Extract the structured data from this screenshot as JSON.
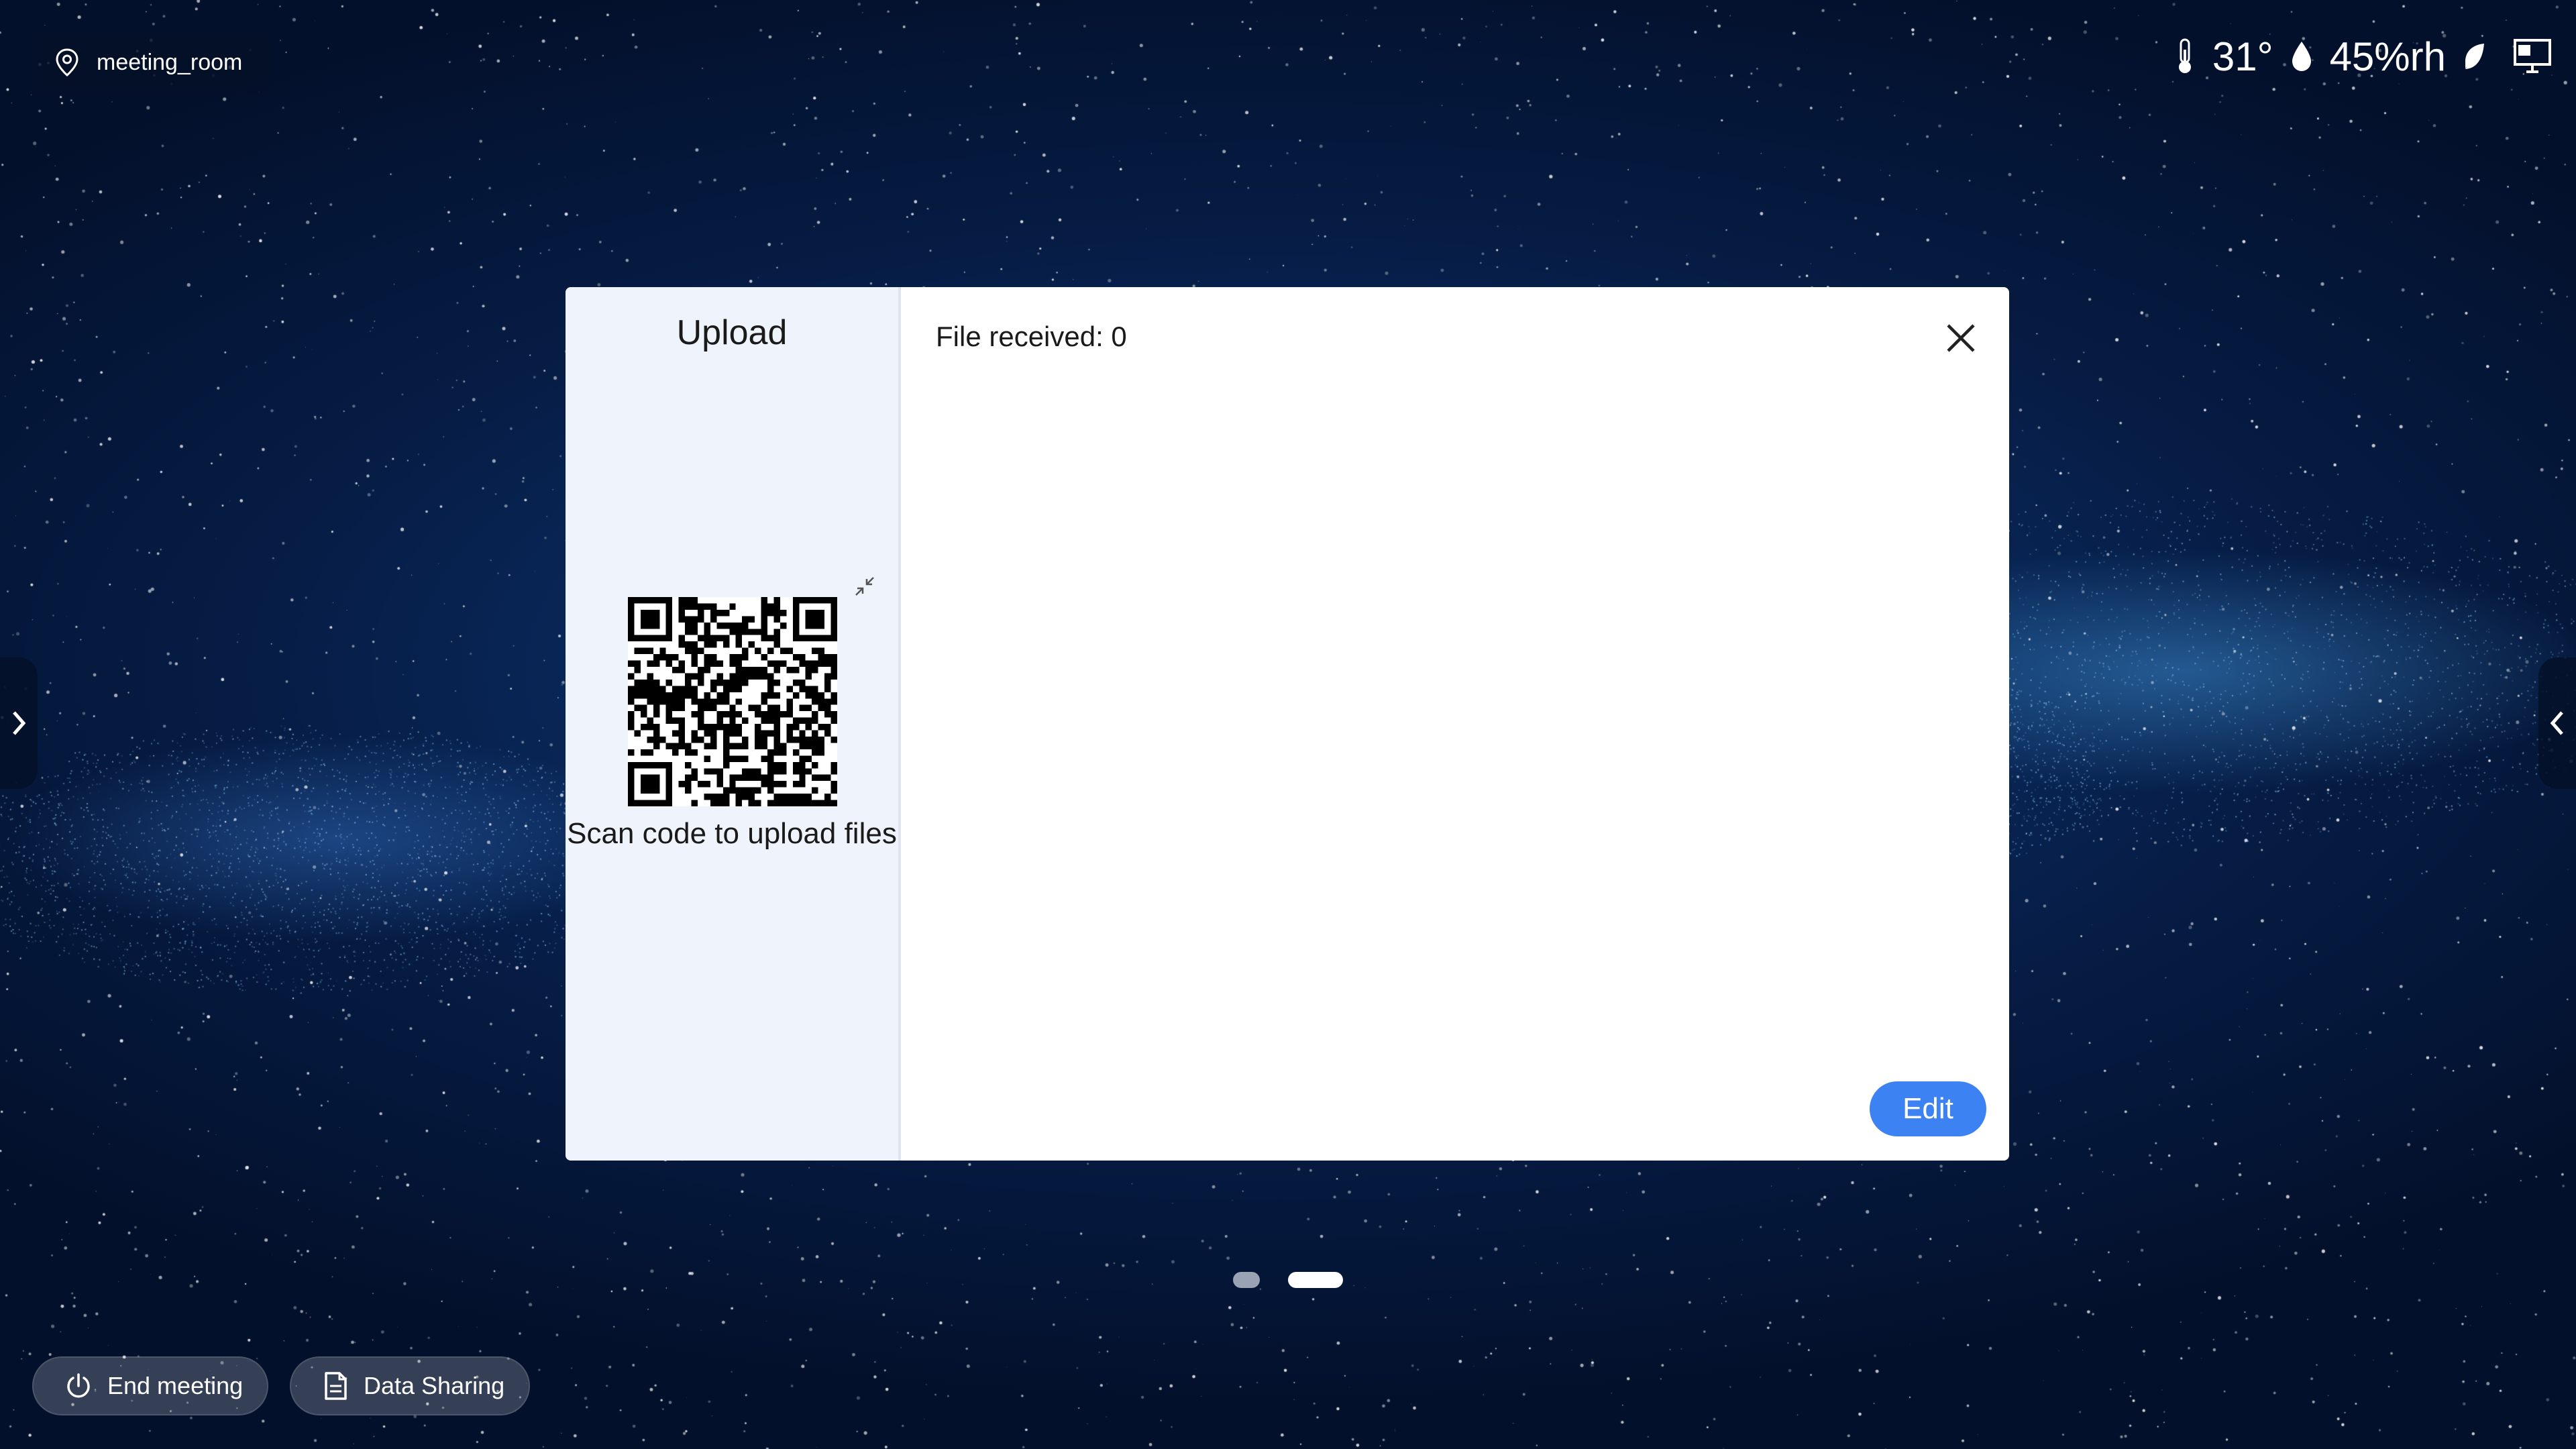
{
  "location": {
    "label": "meeting_room",
    "icon": "location-pin-icon"
  },
  "status": {
    "temperature": "31°",
    "humidity": "45%rh",
    "icons": [
      "thermometer-icon",
      "droplet-icon",
      "leaf-icon",
      "screen-share-icon"
    ]
  },
  "upload_dialog": {
    "title": "Upload",
    "scan_label": "Scan code to upload files",
    "file_received": "File received: 0",
    "edit_label": "Edit"
  },
  "pagination": {
    "total": 2,
    "current": 2
  },
  "bottom_bar": {
    "end_meeting_label": "End meeting",
    "data_sharing_label": "Data Sharing"
  },
  "colors": {
    "accent": "#3d82f3",
    "background_dark": "#061c44",
    "upload_pane": "#eef3fc"
  }
}
